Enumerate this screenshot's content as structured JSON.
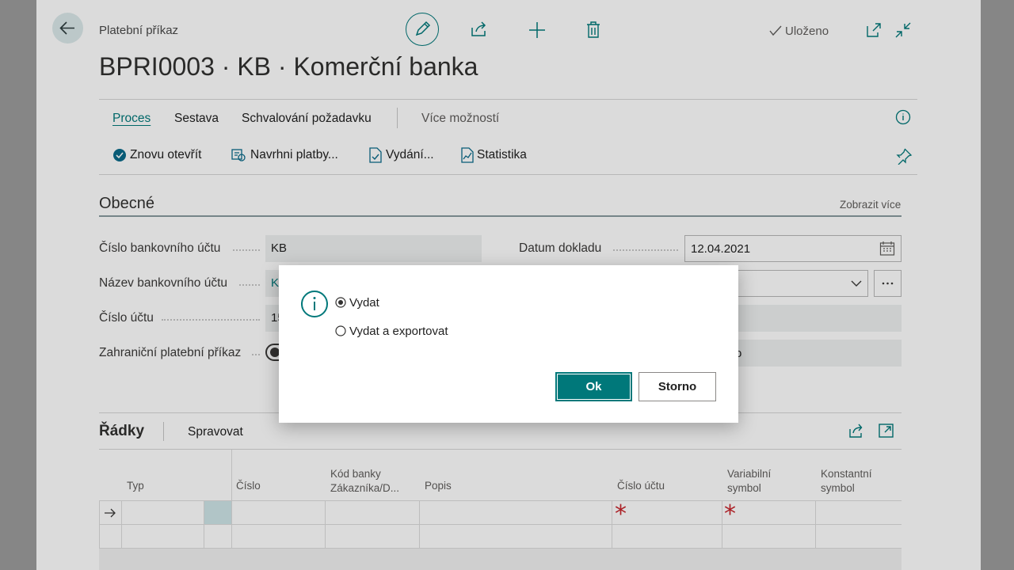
{
  "header": {
    "breadcrumb": "Platební příkaz",
    "title": "BPRI0003 · KB · Komerční banka",
    "saved_status": "Uloženo"
  },
  "tabs": [
    "Proces",
    "Sestava",
    "Schvalování požadavku",
    "Více možností"
  ],
  "actions": [
    "Znovu otevřít",
    "Navrhni platby...",
    "Vydání...",
    "Statistika"
  ],
  "general": {
    "title": "Obecné",
    "show_more": "Zobrazit více",
    "fields": {
      "bank_account_no_label": "Číslo bankovního účtu",
      "bank_account_no_value": "KB",
      "bank_account_name_label": "Název bankovního účtu",
      "bank_account_name_value": "Ko",
      "account_no_label": "Číslo účtu",
      "account_no_value": "15",
      "foreign_label": "Zahraniční platební příkaz",
      "doc_date_label": "Datum dokladu",
      "doc_date_value": "12.04.2021",
      "right_row4_fragment": "o"
    }
  },
  "lines": {
    "title": "Řádky",
    "manage": "Spravovat",
    "columns": [
      "Typ",
      "Číslo",
      "Kód banky Zákazníka/D...",
      "Popis",
      "Číslo účtu",
      "Variabilní symbol",
      "Konstantní symbol"
    ],
    "required_marker": "*"
  },
  "dialog": {
    "options": [
      "Vydat",
      "Vydat a exportovat"
    ],
    "selected_index": 0,
    "ok": "Ok",
    "cancel": "Storno",
    "icon": "info-icon"
  },
  "colors": {
    "accent": "#00787a",
    "required": "#c8262d"
  }
}
